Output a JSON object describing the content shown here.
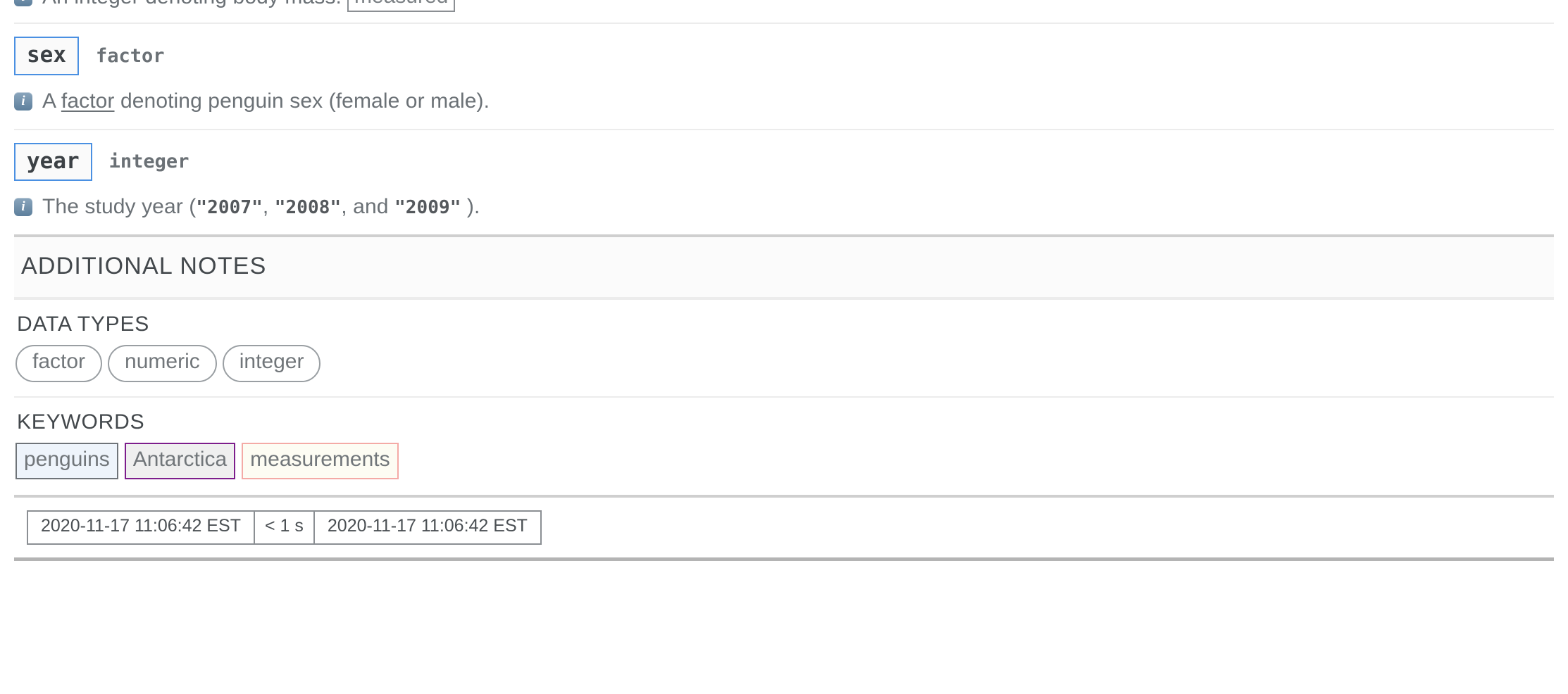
{
  "top_clipped_row": {
    "icon": "info-icon",
    "text": "An integer denoting body mass.",
    "boxed_token": "measured"
  },
  "fields": [
    {
      "name": "sex",
      "type": "factor",
      "description_prefix": "A ",
      "description_link": "factor",
      "description_suffix": " denoting penguin sex (female or male)."
    },
    {
      "name": "year",
      "type": "integer",
      "description_prefix": "The study year (",
      "year_values": [
        "\"2007\"",
        "\"2008\"",
        "\"2009\""
      ],
      "description_mid": ", ",
      "description_and": ", and ",
      "description_suffix": " )."
    }
  ],
  "section": {
    "title": "ADDITIONAL NOTES"
  },
  "data_types": {
    "heading": "DATA TYPES",
    "items": [
      "factor",
      "numeric",
      "integer"
    ]
  },
  "keywords": {
    "heading": "KEYWORDS",
    "items": [
      {
        "label": "penguins",
        "border": "#6f7479",
        "background": "#eef4fb"
      },
      {
        "label": "Antarctica",
        "border": "#7d1d8c",
        "background": "#efefef"
      },
      {
        "label": "measurements",
        "border": "#f4aaa6",
        "background": "#fdfcf3"
      }
    ]
  },
  "footer": {
    "created": "2020-11-17 11:06:42 EST",
    "duration": "< 1 s",
    "modified": "2020-11-17 11:06:42 EST"
  },
  "colors": {
    "accent_blue": "#4a90e2",
    "text": "#555b60",
    "divider": "#ececec",
    "divider_strong": "#cfcfcf"
  }
}
